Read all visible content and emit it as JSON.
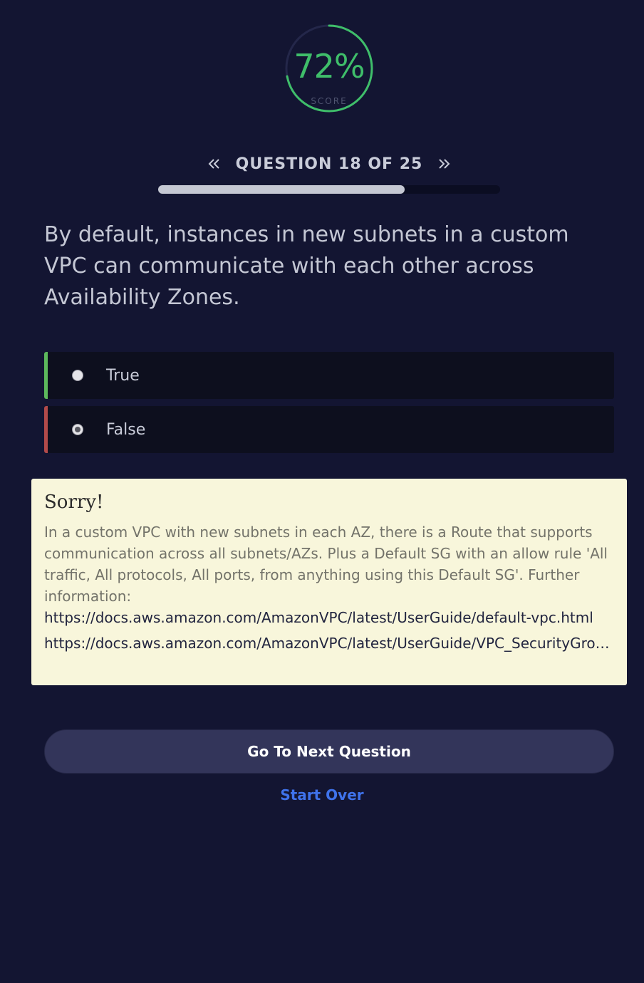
{
  "score": {
    "value": "72%",
    "label": "SCORE",
    "fraction": 0.72,
    "ring_color": "#3fbe6a"
  },
  "nav": {
    "prev_icon": "double-chevron-left-icon",
    "next_icon": "double-chevron-right-icon",
    "question_counter": "QUESTION 18 OF 25",
    "current": 18,
    "total": 25,
    "progress_fraction": 0.72
  },
  "question": {
    "text": "By default, instances in new subnets in a custom VPC can communicate with each other across Availability Zones."
  },
  "answers": [
    {
      "label": "True",
      "selected": false,
      "status": "correct",
      "status_color": "#5cb85c"
    },
    {
      "label": "False",
      "selected": true,
      "status": "wrong",
      "status_color": "#b24a4a"
    }
  ],
  "feedback": {
    "title": "Sorry!",
    "body": "In a custom VPC with new subnets in each AZ, there is a Route that supports communication across all subnets/AZs. Plus a Default SG with an allow rule 'All traffic, All protocols, All ports, from anything using this Default SG'. Further information:",
    "links": [
      "https://docs.aws.amazon.com/AmazonVPC/latest/UserGuide/default-vpc.html",
      "https://docs.aws.amazon.com/AmazonVPC/latest/UserGuide/VPC_SecurityGroups.html"
    ],
    "background": "#f8f6db"
  },
  "actions": {
    "next_label": "Go To Next Question",
    "start_over_label": "Start Over"
  },
  "colors": {
    "background": "#131532",
    "accent_link": "#3f73ec",
    "button": "#33355a"
  }
}
